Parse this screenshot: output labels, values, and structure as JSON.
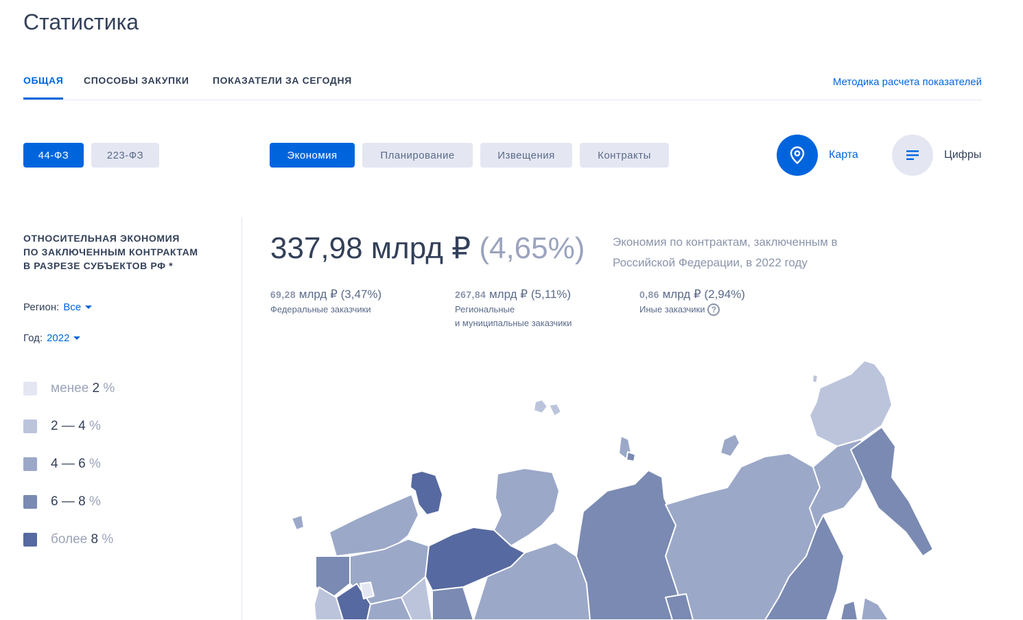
{
  "page": {
    "title": "Статистика"
  },
  "tabs": [
    {
      "label": "ОБЩАЯ",
      "active": true
    },
    {
      "label": "СПОСОБЫ ЗАКУПКИ",
      "active": false
    },
    {
      "label": "ПОКАЗАТЕЛИ ЗА СЕГОДНЯ",
      "active": false
    }
  ],
  "method_link": "Методика расчета показателей",
  "law_pills": [
    {
      "label": "44-ФЗ",
      "active": true
    },
    {
      "label": "223-ФЗ",
      "active": false
    }
  ],
  "category_pills": [
    {
      "label": "Экономия",
      "active": true
    },
    {
      "label": "Планирование",
      "active": false
    },
    {
      "label": "Извещения",
      "active": false
    },
    {
      "label": "Контракты",
      "active": false
    }
  ],
  "view_toggle": {
    "map": {
      "label": "Карта",
      "icon": "map-pin-icon",
      "active": true
    },
    "numbers": {
      "label": "Цифры",
      "icon": "lines-icon",
      "active": false
    }
  },
  "sidebar": {
    "title_lines": [
      "ОТНОСИТЕЛЬНАЯ ЭКОНОМИЯ",
      "ПО ЗАКЛЮЧЕННЫМ КОНТРАКТАМ",
      "В РАЗРЕЗЕ СУБЪЕКТОВ РФ *"
    ],
    "region": {
      "label": "Регион:",
      "value": "Все"
    },
    "year": {
      "label": "Год:",
      "value": "2022"
    },
    "legend": [
      {
        "prefix": "менее",
        "range": "2",
        "unit": "%",
        "color": "#e4e7f2"
      },
      {
        "prefix": "",
        "range": "2 — 4",
        "unit": "%",
        "color": "#bcc4dc"
      },
      {
        "prefix": "",
        "range": "4 — 6",
        "unit": "%",
        "color": "#9ba8c8"
      },
      {
        "prefix": "",
        "range": "6 — 8",
        "unit": "%",
        "color": "#7a8ab2"
      },
      {
        "prefix": "более",
        "range": "8",
        "unit": "%",
        "color": "#5669a0"
      }
    ]
  },
  "summary": {
    "total_value": "337,98 млрд ₽",
    "total_pct": "(4,65%)",
    "description": "Экономия по контрактам, заключенным в Российской Федерации, в 2022 году"
  },
  "breakdown": [
    {
      "value": "69,28",
      "unit": "млрд ₽ (3,47%)",
      "caption": "Федеральные заказчики",
      "caption2": ""
    },
    {
      "value": "267,84",
      "unit": "млрд ₽ (5,11%)",
      "caption": "Региональные",
      "caption2": "и муниципальные заказчики"
    },
    {
      "value": "0,86",
      "unit": "млрд ₽ (2,94%)",
      "caption": "Иные заказчики",
      "caption2": ""
    }
  ],
  "help_icon": "?",
  "map": {
    "name": "russia-regions-map"
  }
}
